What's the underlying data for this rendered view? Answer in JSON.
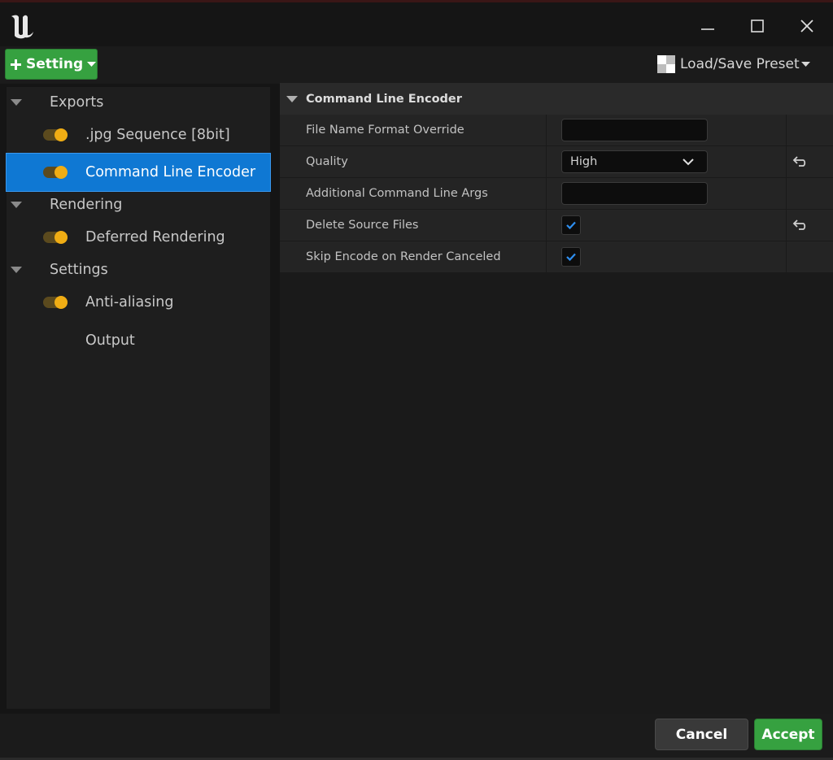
{
  "toolbar": {
    "add_setting_label": "Setting",
    "preset_label": "Load/Save Preset"
  },
  "tree": {
    "groups": [
      {
        "label": "Exports",
        "items": [
          {
            "label": ".jpg Sequence [8bit]",
            "enabled": true
          },
          {
            "label": "Command Line Encoder",
            "enabled": true,
            "selected": true
          }
        ]
      },
      {
        "label": "Rendering",
        "items": [
          {
            "label": "Deferred Rendering",
            "enabled": true
          }
        ]
      },
      {
        "label": "Settings",
        "items": [
          {
            "label": "Anti-aliasing",
            "enabled": true
          },
          {
            "label": "Output",
            "enabled": null
          }
        ]
      }
    ]
  },
  "details": {
    "section_title": "Command Line Encoder",
    "properties": [
      {
        "label": "File Name Format Override",
        "type": "text",
        "value": ""
      },
      {
        "label": "Quality",
        "type": "combo",
        "value": "High",
        "resettable": true
      },
      {
        "label": "Additional Command Line Args",
        "type": "text",
        "value": ""
      },
      {
        "label": "Delete Source Files",
        "type": "checkbox",
        "checked": true,
        "resettable": true
      },
      {
        "label": "Skip Encode on Render Canceled",
        "type": "checkbox",
        "checked": true
      }
    ]
  },
  "footer": {
    "cancel_label": "Cancel",
    "accept_label": "Accept"
  },
  "colors": {
    "accent_green": "#36a140",
    "selection_blue": "#0f78d3",
    "toggle_on": "#f0ad14",
    "checkmark": "#2e8ff0"
  }
}
